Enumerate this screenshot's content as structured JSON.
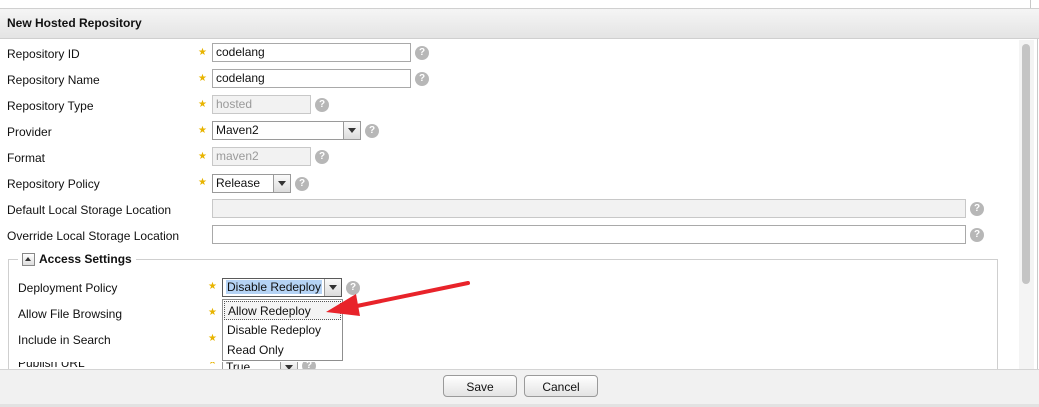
{
  "panel": {
    "title": "New Hosted Repository"
  },
  "fields": {
    "repository_id": {
      "label": "Repository ID",
      "value": "codelang"
    },
    "repository_name": {
      "label": "Repository Name",
      "value": "codelang"
    },
    "repository_type": {
      "label": "Repository Type",
      "value": "hosted"
    },
    "provider": {
      "label": "Provider",
      "value": "Maven2"
    },
    "format": {
      "label": "Format",
      "value": "maven2"
    },
    "repository_policy": {
      "label": "Repository Policy",
      "value": "Release"
    },
    "default_storage": {
      "label": "Default Local Storage Location",
      "value": ""
    },
    "override_storage": {
      "label": "Override Local Storage Location",
      "value": ""
    }
  },
  "access_settings": {
    "legend": "Access Settings",
    "deployment_policy": {
      "label": "Deployment Policy",
      "value": "Disable Redeploy"
    },
    "allow_file_browsing": {
      "label": "Allow File Browsing"
    },
    "include_in_search": {
      "label": "Include in Search"
    },
    "publish_url": {
      "label": "Publish URL",
      "value": "True"
    }
  },
  "dropdown": {
    "options": [
      "Allow Redeploy",
      "Disable Redeploy",
      "Read Only"
    ],
    "hovered": "Allow Redeploy"
  },
  "annotation": {
    "arrow_color": "#e8232a"
  },
  "buttons": {
    "save": "Save",
    "cancel": "Cancel"
  },
  "help_glyph": "?",
  "colors": {
    "required_star": "#e8b400",
    "selection_highlight": "#b5d3f5"
  }
}
